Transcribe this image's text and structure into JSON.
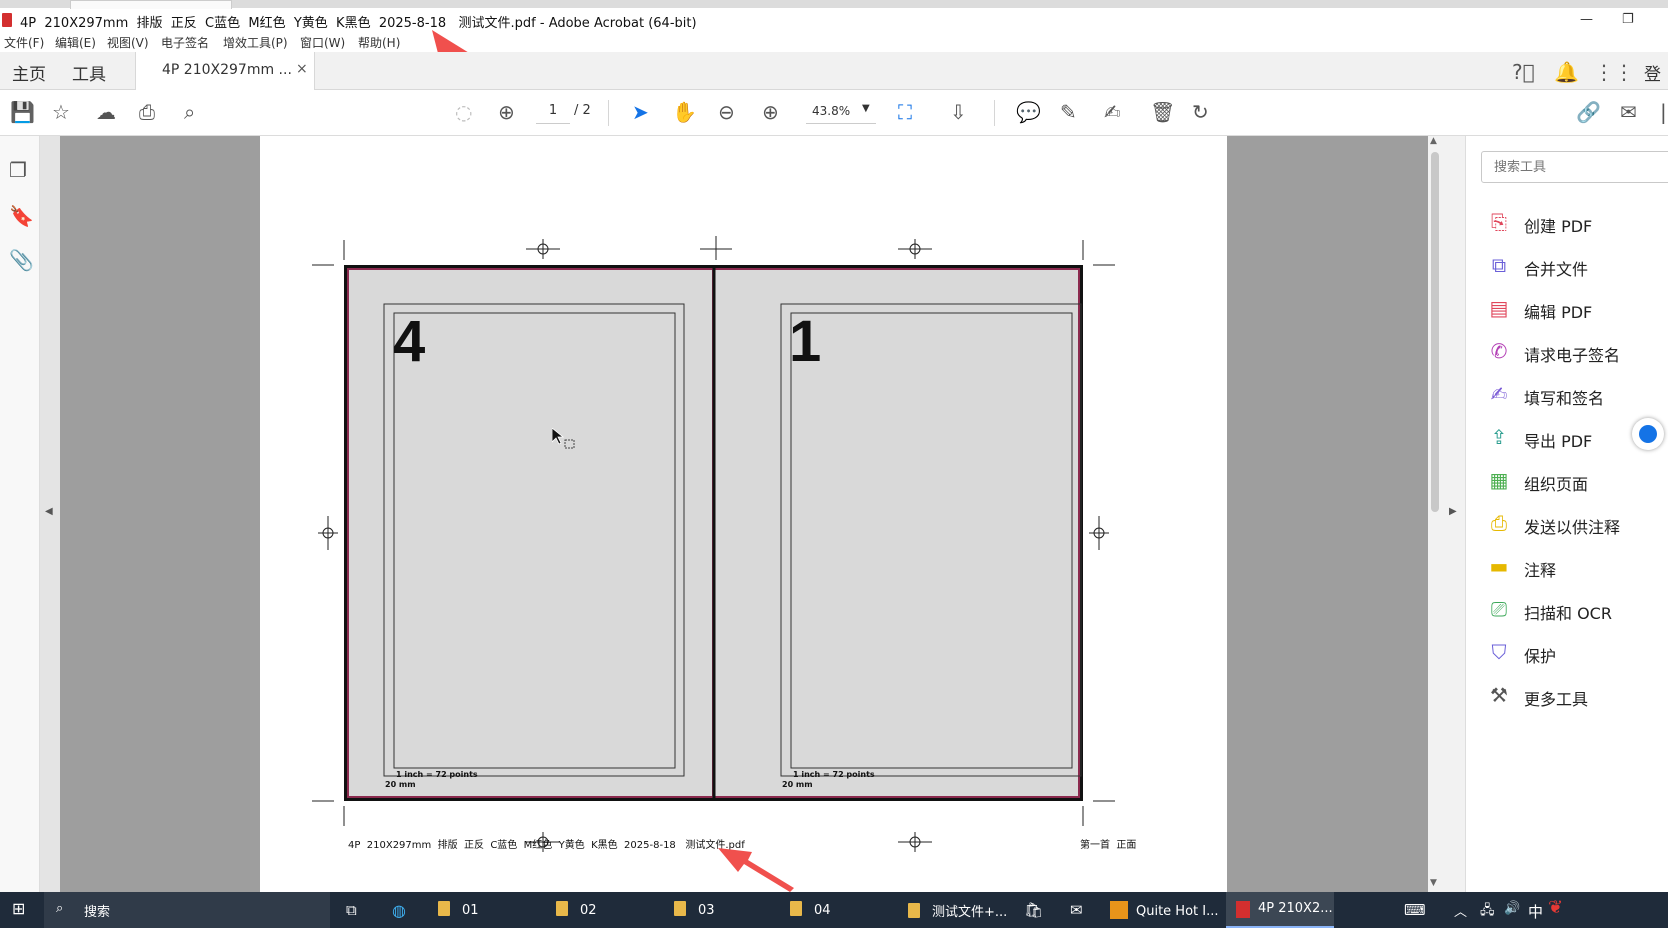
{
  "window": {
    "title": "4P  210X297mm  排版  正反  C蓝色  M红色  Y黄色  K黑色  2025-8-18   测试文件.pdf - Adobe Acrobat (64-bit)",
    "minimize": "—",
    "restore": "❐"
  },
  "menu": [
    "文件(F)",
    "编辑(E)",
    "视图(V)",
    "电子签名",
    "增效工具(P)",
    "窗口(W)",
    "帮助(H)"
  ],
  "tabs": {
    "home": "主页",
    "tools": "工具",
    "document": "4P  210X297mm  ...",
    "close": "×",
    "login": "登录"
  },
  "toolbar": {
    "page_current": "1",
    "page_total": "/ 2",
    "zoom": "43.8%"
  },
  "page": {
    "left_number": "4",
    "right_number": "1",
    "scale_note": "1 inch = 72 points",
    "margin_note": "20 mm",
    "slug_left": "4P  210X297mm  排版  正反  C蓝色  M红色  Y黄色  K黑色  2025-8-18   测试文件.pdf",
    "slug_right": "第一首  正面"
  },
  "right_panel": {
    "search_placeholder": "搜索工具",
    "tools": [
      {
        "label": "创建 PDF",
        "icon": "create-pdf-icon",
        "color": "#e0475c"
      },
      {
        "label": "合并文件",
        "icon": "combine-files-icon",
        "color": "#6a5fd8"
      },
      {
        "label": "编辑 PDF",
        "icon": "edit-pdf-icon",
        "color": "#e0475c"
      },
      {
        "label": "请求电子签名",
        "icon": "request-signature-icon",
        "color": "#b33fb5"
      },
      {
        "label": "填写和签名",
        "icon": "fill-sign-icon",
        "color": "#7b5cd6"
      },
      {
        "label": "导出 PDF",
        "icon": "export-pdf-icon",
        "color": "#2a9d8f"
      },
      {
        "label": "组织页面",
        "icon": "organize-pages-icon",
        "color": "#4caf50"
      },
      {
        "label": "发送以供注释",
        "icon": "send-comment-icon",
        "color": "#e6b800"
      },
      {
        "label": "注释",
        "icon": "comment-icon",
        "color": "#e6b800"
      },
      {
        "label": "扫描和 OCR",
        "icon": "scan-ocr-icon",
        "color": "#3aa757"
      },
      {
        "label": "保护",
        "icon": "protect-icon",
        "color": "#6a5fd8"
      },
      {
        "label": "更多工具",
        "icon": "more-tools-icon",
        "color": "#555555"
      }
    ]
  },
  "taskbar": {
    "search": "搜索",
    "items": [
      "01",
      "02",
      "03",
      "04",
      "测试文件+...",
      "Quite Hot I...",
      "4P  210X2..."
    ],
    "ime": "中"
  }
}
